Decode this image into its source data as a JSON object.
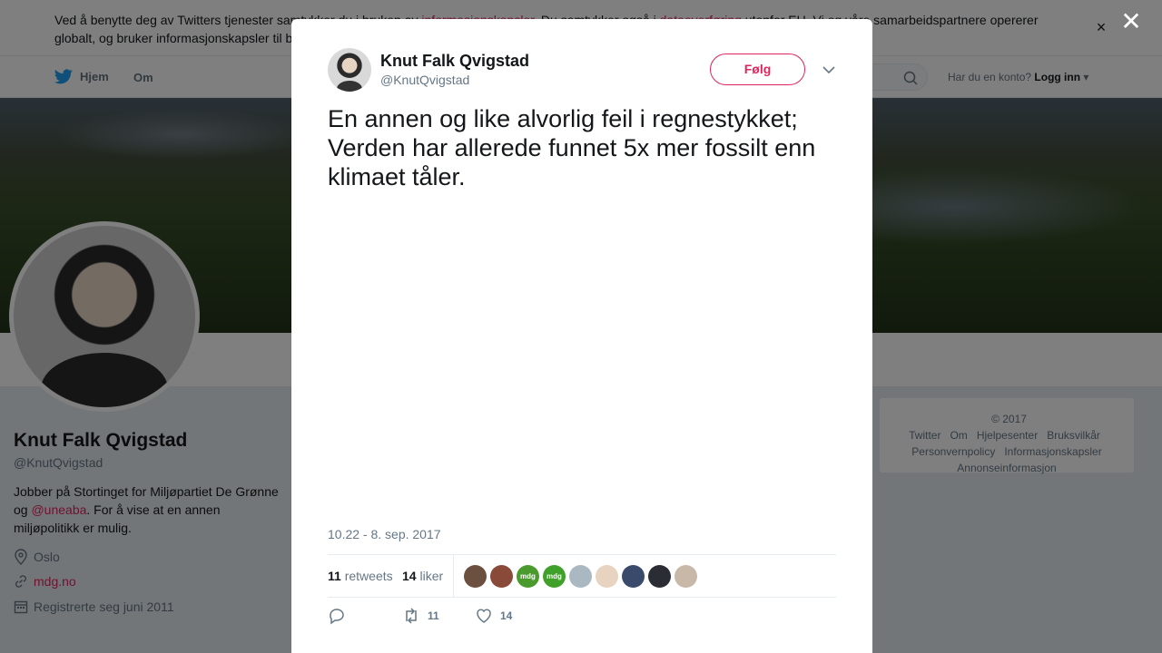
{
  "cookie": {
    "text_1": "Ved å benytte deg av Twitters tjenester samtykker du i bruken av ",
    "link_1": "informasjonskapsler",
    "text_2": ". Du samtykker også i ",
    "link_2": "dataoverføring",
    "text_3": " utenfor EU. Vi og våre samarbeidspartnere opererer globalt, og bruker informasjonskapsler til b",
    "close": "×"
  },
  "nav": {
    "home": "Hjem",
    "about": "Om",
    "account_prompt": "Har du en konto?",
    "login": "Logg inn"
  },
  "profile": {
    "name": "Knut Falk Qvigstad",
    "handle": "@KnutQvigstad",
    "bio_1": "Jobber på Stortinget for Miljøpartiet De Grønne og ",
    "bio_link": "@uneaba",
    "bio_2": ". For å vise at en annen miljøpolitikk er mulig.",
    "location": "Oslo",
    "website": "mdg.no",
    "joined": "Registrerte seg juni 2011"
  },
  "footer": {
    "copyright": "© 2017 Twitter",
    "about": "Om",
    "help": "Hjelpesenter",
    "terms": "Bruksvilkår",
    "privacy": "Personvernpolicy",
    "cookies": "Informasjonskapsler",
    "ads": "Annonseinformasjon"
  },
  "overlay": {
    "close": "✕"
  },
  "tweet": {
    "author_name": "Knut Falk Qvigstad",
    "author_handle": "@KnutQvigstad",
    "follow_label": "Følg",
    "text": "En annen og like alvorlig feil i regnestykket; Verden har allerede funnet 5x mer fossilt enn klimaet tåler.",
    "timestamp": "10.22 - 8. sep. 2017",
    "retweets_count": "11",
    "retweets_label": "retweets",
    "likes_count": "14",
    "likes_label": "liker",
    "mdg_label": "mdg",
    "retweet_action_count": "11",
    "like_action_count": "14"
  },
  "colors": {
    "accent": "#e0245e",
    "twitter_blue": "#1da1f2",
    "muted": "#657786"
  }
}
